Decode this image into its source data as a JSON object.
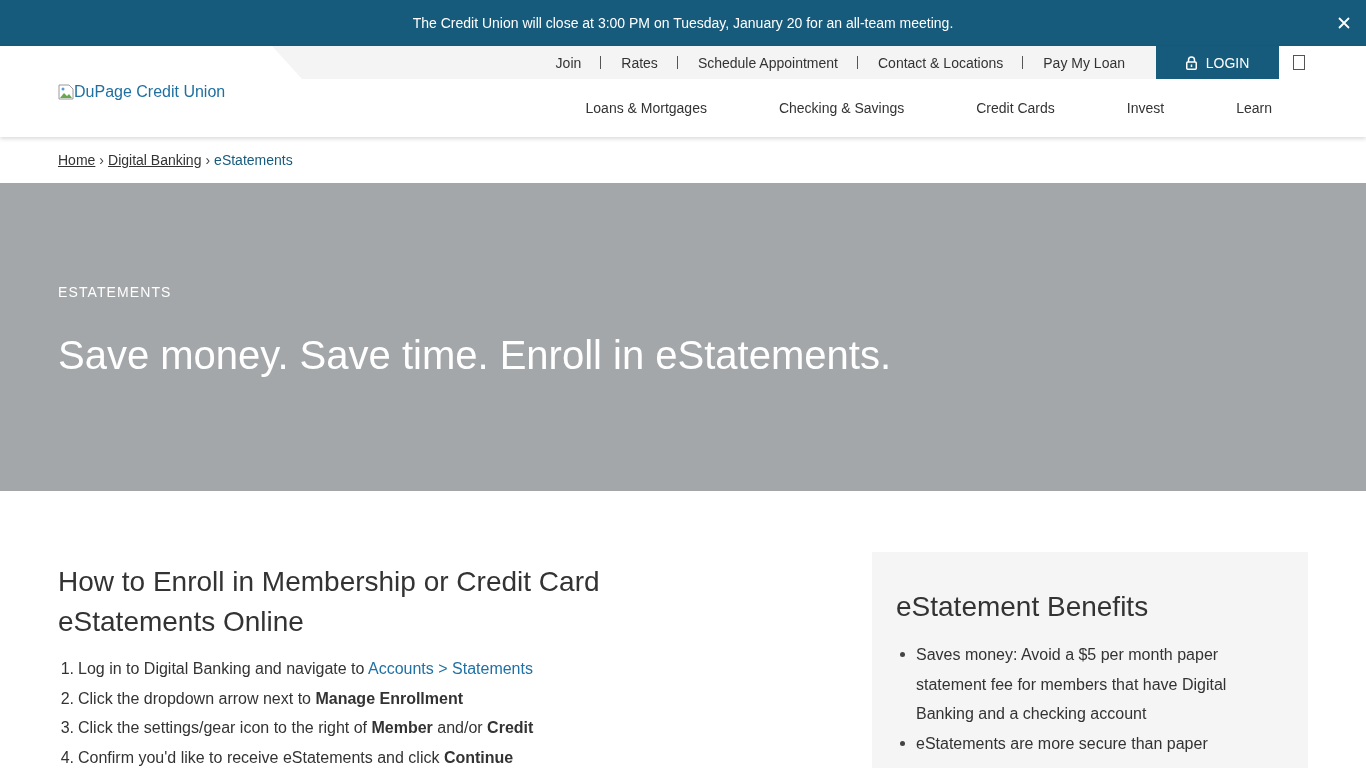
{
  "alert": {
    "message": "The Credit Union will close at 3:00 PM on Tuesday, January 20 for an all-team meeting."
  },
  "header": {
    "logo": {
      "alt_text": "DuPage Credit Union"
    },
    "utility_links": [
      "Join",
      "Rates",
      "Schedule Appointment",
      "Contact & Locations",
      "Pay My Loan"
    ],
    "login_button": "LOGIN",
    "main_nav": [
      "Loans & Mortgages",
      "Checking & Savings",
      "Credit Cards",
      "Invest",
      "Learn"
    ]
  },
  "breadcrumb": {
    "items": [
      {
        "label": "Home",
        "current": false
      },
      {
        "label": "Digital Banking",
        "separator": "›",
        "current": false
      },
      {
        "label": "eStatements",
        "separator": "›",
        "current": true
      }
    ]
  },
  "hero": {
    "eyebrow": "ESTATEMENTS",
    "title": "Save money. Save time. Enroll in eStatements."
  },
  "enroll_section": {
    "title": "How to Enroll in Membership or Credit Card eStatements Online",
    "steps": [
      {
        "number": "1.",
        "text": "Log in to Digital Banking and navigate to ",
        "link": "Accounts > Statements"
      },
      {
        "number": "2.",
        "text": "Click the dropdown arrow next to **Manage Enrollment**"
      },
      {
        "number": "3.",
        "text": "Click the settings/gear icon to the right of **Member** and/or **Credit**"
      },
      {
        "number": "4.",
        "text": "Confirm you'd like to receive eStatements and click **Continue**"
      }
    ]
  },
  "benefits": {
    "title": "eStatement Benefits",
    "items": [
      "Saves money: Avoid a $5 per month paper statement fee for members that have Digital Banking and a checking account",
      "eStatements are more secure than paper"
    ]
  }
}
